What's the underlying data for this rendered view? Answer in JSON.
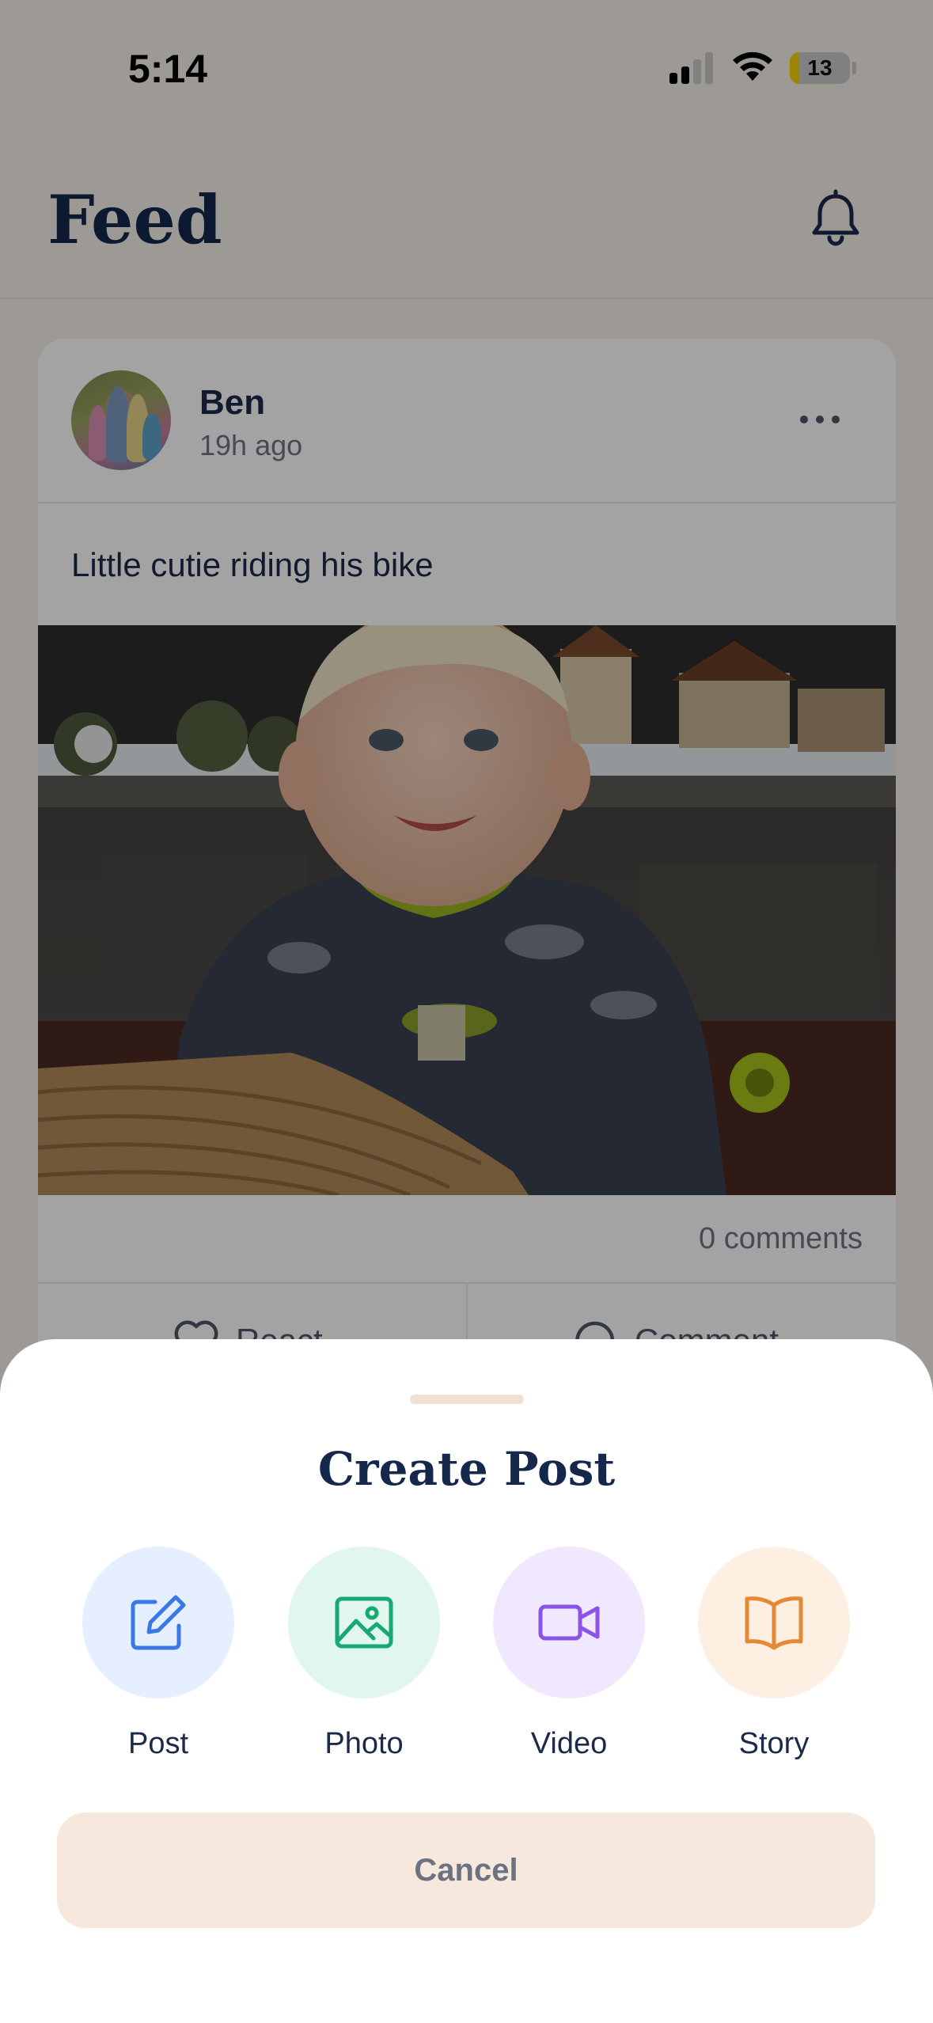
{
  "status_bar": {
    "time": "5:14",
    "battery": "13"
  },
  "header": {
    "title": "Feed"
  },
  "post": {
    "author": "Ben",
    "time_ago": "19h ago",
    "text": "Little cutie riding his bike",
    "comments": "0 comments",
    "react_label": "React",
    "comment_label": "Comment"
  },
  "sheet": {
    "title": "Create Post",
    "options": [
      {
        "label": "Post",
        "icon": "edit-icon",
        "bg": "#e6efff",
        "color": "#3a78e6"
      },
      {
        "label": "Photo",
        "icon": "image-icon",
        "bg": "#e1f7ee",
        "color": "#17a974"
      },
      {
        "label": "Video",
        "icon": "video-icon",
        "bg": "#efe8ff",
        "color": "#8a55e6"
      },
      {
        "label": "Story",
        "icon": "book-icon",
        "bg": "#fdf0e3",
        "color": "#e48a35"
      }
    ],
    "cancel_label": "Cancel"
  }
}
